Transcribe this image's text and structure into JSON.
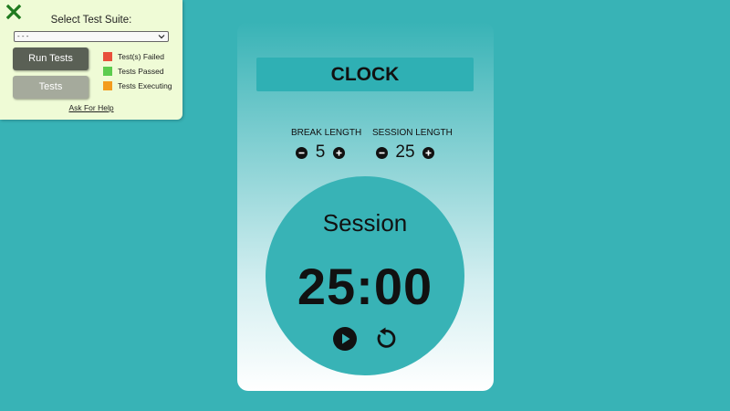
{
  "test_panel": {
    "close_icon": "close-x-icon",
    "suite_label": "Select Test Suite:",
    "suite_selected": "- - -",
    "run_tests_label": "Run Tests",
    "tests_label": "Tests",
    "legend": [
      {
        "label": "Test(s) Failed",
        "color": "#e8503c"
      },
      {
        "label": "Tests Passed",
        "color": "#5ccc4e"
      },
      {
        "label": "Tests Executing",
        "color": "#f39c1e"
      }
    ],
    "help_link": "Ask For Help"
  },
  "clock": {
    "title": "CLOCK",
    "break": {
      "label": "BREAK LENGTH",
      "value": "5"
    },
    "session": {
      "label": "SESSION LENGTH",
      "value": "25"
    },
    "timer_label": "Session",
    "time_left": "25:00",
    "play_icon": "play-icon",
    "reset_icon": "reset-icon"
  },
  "colors": {
    "background": "#38b3b6",
    "panel": "#effbd6",
    "dial": "#38b3b6"
  }
}
